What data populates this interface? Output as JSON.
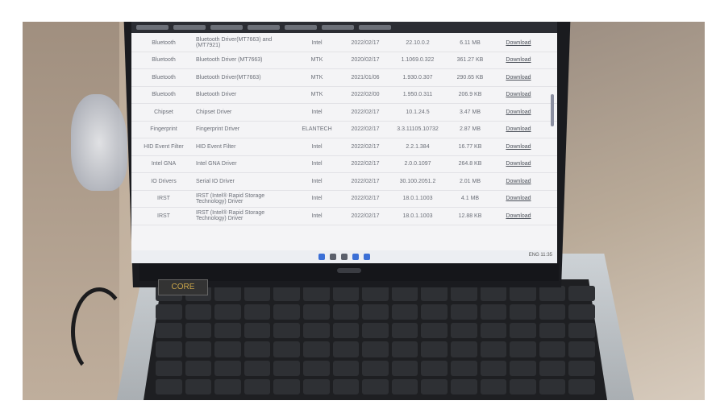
{
  "screen": {
    "columns": [
      "",
      "",
      "",
      "",
      "",
      "",
      ""
    ],
    "rows": [
      {
        "category": "Bluetooth",
        "description": "Bluetooth Driver(MT7663) and (MT7921)",
        "vendor": "Intel",
        "date": "2022/02/17",
        "version": "22.10.0.2",
        "size": "6.11 MB",
        "action": "Download"
      },
      {
        "category": "Bluetooth",
        "description": "Bluetooth Driver (MT7663)",
        "vendor": "MTK",
        "date": "2020/02/17",
        "version": "1.1069.0.322",
        "size": "361.27 KB",
        "action": "Download"
      },
      {
        "category": "Bluetooth",
        "description": "Bluetooth Driver(MT7663)",
        "vendor": "MTK",
        "date": "2021/01/06",
        "version": "1.930.0.307",
        "size": "290.65 KB",
        "action": "Download"
      },
      {
        "category": "Bluetooth",
        "description": "Bluetooth Driver",
        "vendor": "MTK",
        "date": "2022/02/00",
        "version": "1.950.0.311",
        "size": "206.9 KB",
        "action": "Download"
      },
      {
        "category": "Chipset",
        "description": "Chipset Driver",
        "vendor": "Intel",
        "date": "2022/02/17",
        "version": "10.1.24.5",
        "size": "3.47 MB",
        "action": "Download"
      },
      {
        "category": "Fingerprint",
        "description": "Fingerprint Driver",
        "vendor": "ELANTECH",
        "date": "2022/02/17",
        "version": "3.3.11105.10732",
        "size": "2.87 MB",
        "action": "Download"
      },
      {
        "category": "HID Event Filter",
        "description": "HID Event Filter",
        "vendor": "Intel",
        "date": "2022/02/17",
        "version": "2.2.1.384",
        "size": "16.77 KB",
        "action": "Download"
      },
      {
        "category": "Intel GNA",
        "description": "Intel GNA Driver",
        "vendor": "Intel",
        "date": "2022/02/17",
        "version": "2.0.0.1097",
        "size": "264.8 KB",
        "action": "Download"
      },
      {
        "category": "IO Drivers",
        "description": "Serial IO Driver",
        "vendor": "Intel",
        "date": "2022/02/17",
        "version": "30.100.2051.2",
        "size": "2.01 MB",
        "action": "Download"
      },
      {
        "category": "IRST",
        "description": "IRST (Intel® Rapid Storage Technology) Driver",
        "vendor": "Intel",
        "date": "2022/02/17",
        "version": "18.0.1.1003",
        "size": "4.1 MB",
        "action": "Download"
      },
      {
        "category": "IRST",
        "description": "IRST (Intel® Rapid Storage Technology) Driver",
        "vendor": "Intel",
        "date": "2022/02/17",
        "version": "18.0.1.1003",
        "size": "12.88 KB",
        "action": "Download"
      }
    ],
    "tray_time": "ENG 11:35",
    "sticker": "CORE"
  },
  "colors": {
    "screen_bg": "#f4f4f6",
    "keyboard": "#1e1f22",
    "chassis": "#c2c7cb",
    "taskbar_accent": "#3b6fd6"
  }
}
